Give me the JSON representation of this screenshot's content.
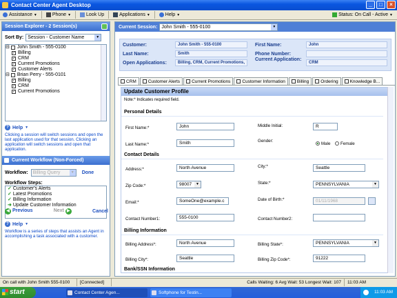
{
  "window": {
    "title": "Contact Center Agent Desktop"
  },
  "toolbar": {
    "assistance": "Assistance",
    "phone": "Phone",
    "lookup": "Look Up",
    "applications": "Applications",
    "help": "Help",
    "status": "Status: On Call - Active"
  },
  "session_explorer": {
    "title": "Session Explorer - 2 Session(s)",
    "sort_label": "Sort By:",
    "sort_value": "Session - Customer Name",
    "tree": [
      {
        "label": "John Smith - 555-0100",
        "level": 0
      },
      {
        "label": "Billing",
        "level": 1
      },
      {
        "label": "CRM",
        "level": 1
      },
      {
        "label": "Current Promotions",
        "level": 1
      },
      {
        "label": "Customer Alerts",
        "level": 1
      },
      {
        "label": "Brian Perry - 555-0101",
        "level": 0
      },
      {
        "label": "Billing",
        "level": 1
      },
      {
        "label": "CRM",
        "level": 1
      },
      {
        "label": "Current Promotions",
        "level": 1
      }
    ],
    "help_label": "Help",
    "help_text": "Clicking a session will switch sessions and open the last application used for that session. Clicking an application will switch sessions and open that application."
  },
  "workflow": {
    "title": "Current Workflow (Non-Forced)",
    "workflows_label": "Workflow:",
    "workflow_value": "Billing Query",
    "done_label": "Done",
    "steps_label": "Workflow Steps:",
    "steps": [
      {
        "label": "Customer's Alerts",
        "state": "done"
      },
      {
        "label": "Latest Promotions",
        "state": "done"
      },
      {
        "label": "Billing Information",
        "state": "done"
      },
      {
        "label": "Update Customer Information",
        "state": "current"
      }
    ],
    "previous_label": "Previous",
    "next_label": "Next",
    "cancel_label": "Cancel",
    "help_label": "Help",
    "help_text": "Workflow is a series of steps that assists an Agent in accomplishing a task associated with a customer."
  },
  "main": {
    "current_session_label": "Current Session:",
    "current_session_value": "John Smith - 555-0100",
    "customer": {
      "customer_label": "Customer:",
      "customer_value": "John Smith - 555-0100",
      "first_name_label": "First Name:",
      "first_name_value": "John",
      "last_name_label": "Last Name:",
      "last_name_value": "Smith",
      "phone_label": "Phone Number:",
      "phone_value": "",
      "open_apps_label": "Open Applications:",
      "open_apps_value": "Billing, CRM, Current Promotions,",
      "current_app_label": "Current Application:",
      "current_app_value": "CRM"
    },
    "tabs": [
      "CRM",
      "Customer Alerts",
      "Current Promotions",
      "Customer Information",
      "Billing",
      "Ordering",
      "Knowledge B..."
    ],
    "form": {
      "title": "Update Customer Profile",
      "note": "Note:* Indicates required field.",
      "personal_section": "Personal Details",
      "first_name_label": "First Name:*",
      "first_name": "John",
      "middle_label": "Middle Initial:",
      "middle": "R",
      "last_name_label": "Last Name:*",
      "last_name": "Smith",
      "gender_label": "Gender:",
      "male": "Male",
      "female": "Female",
      "contact_section": "Contact Details",
      "address_label": "Address:*",
      "address": "North Avenue",
      "city_label": "City:*",
      "city": "Seattle",
      "zip_label": "Zip Code:*",
      "zip": "98007",
      "state_label": "State:*",
      "state": "PENNSYLVANIA",
      "email_label": "Email:*",
      "email": "SomeOne@example.c",
      "dob_label": "Date of Birth:*",
      "dob": "01/11/1968",
      "contact1_label": "Contact Number1:",
      "contact1": "555-0100",
      "contact2_label": "Contact Number2:",
      "contact2": "",
      "billing_section": "Billing Information",
      "billing_address_label": "Billing Address*:",
      "billing_address": "North Avenue",
      "billing_state_label": "Billing State*:",
      "billing_state": "PENNSYLVANIA",
      "billing_city_label": "Billing City*:",
      "billing_city": "Seattle",
      "billing_zip_label": "Billing Zip Code*:",
      "billing_zip": "91222",
      "bank_section": "Bank/SSN Information"
    }
  },
  "statusbar": {
    "call": "On call with John Smith  555-0100",
    "connected": "[Connected]",
    "stats": "Calls Waiting: 6  Avg Wait: 53  Longest Wait: 107",
    "time": "11:03 AM"
  },
  "taskbar": {
    "start": "start",
    "task1": "Contact Center Agen...",
    "task2": "Softphone for Testin...",
    "clock": "11:03 AM"
  }
}
